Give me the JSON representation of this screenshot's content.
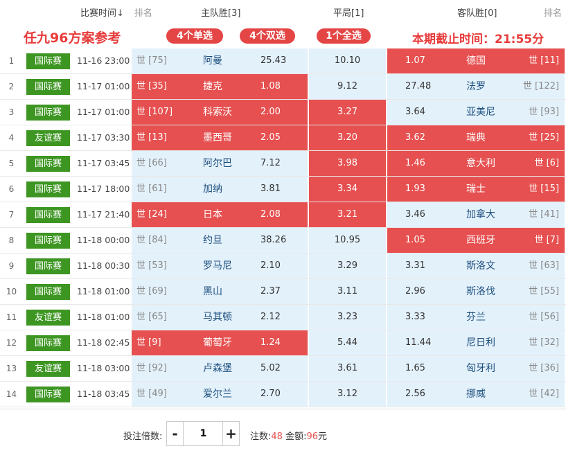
{
  "header": {
    "match_time": "比赛时间↓",
    "rank_left": "排名",
    "home_win": "主队胜[3]",
    "draw": "平局[1]",
    "away_win": "客队胜[0]",
    "rank_right": "排名"
  },
  "promo": {
    "title": "任九96方案参考",
    "single": "4个单选",
    "double": "4个双选",
    "full": "1个全选",
    "deadline": "本期截止时间：21:55分"
  },
  "matches": [
    {
      "no": "1",
      "league": "国际赛",
      "time": "11-16 23:00",
      "home_rank": "世 [75]",
      "home": "阿曼",
      "odds_home": "25.43",
      "odds_draw": "10.10",
      "odds_away": "1.07",
      "away": "德国",
      "away_rank": "世 [11]",
      "sel": [
        "away"
      ]
    },
    {
      "no": "2",
      "league": "国际赛",
      "time": "11-17 01:00",
      "home_rank": "世 [35]",
      "home": "捷克",
      "odds_home": "1.08",
      "odds_draw": "9.12",
      "odds_away": "27.48",
      "away": "法罗",
      "away_rank": "世 [122]",
      "sel": [
        "home"
      ]
    },
    {
      "no": "3",
      "league": "国际赛",
      "time": "11-17 01:00",
      "home_rank": "世 [107]",
      "home": "科索沃",
      "odds_home": "2.00",
      "odds_draw": "3.27",
      "odds_away": "3.64",
      "away": "亚美尼",
      "away_rank": "世 [93]",
      "sel": [
        "home",
        "draw"
      ]
    },
    {
      "no": "4",
      "league": "友谊赛",
      "time": "11-17 03:30",
      "home_rank": "世 [13]",
      "home": "墨西哥",
      "odds_home": "2.05",
      "odds_draw": "3.20",
      "odds_away": "3.62",
      "away": "瑞典",
      "away_rank": "世 [25]",
      "sel": [
        "home",
        "draw",
        "away"
      ]
    },
    {
      "no": "5",
      "league": "国际赛",
      "time": "11-17 03:45",
      "home_rank": "世 [66]",
      "home": "阿尔巴",
      "odds_home": "7.12",
      "odds_draw": "3.98",
      "odds_away": "1.46",
      "away": "意大利",
      "away_rank": "世 [6]",
      "sel": [
        "draw",
        "away"
      ]
    },
    {
      "no": "6",
      "league": "国际赛",
      "time": "11-17 18:00",
      "home_rank": "世 [61]",
      "home": "加纳",
      "odds_home": "3.81",
      "odds_draw": "3.34",
      "odds_away": "1.93",
      "away": "瑞士",
      "away_rank": "世 [15]",
      "sel": [
        "draw",
        "away"
      ]
    },
    {
      "no": "7",
      "league": "国际赛",
      "time": "11-17 21:40",
      "home_rank": "世 [24]",
      "home": "日本",
      "odds_home": "2.08",
      "odds_draw": "3.21",
      "odds_away": "3.46",
      "away": "加拿大",
      "away_rank": "世 [41]",
      "sel": [
        "home",
        "draw"
      ]
    },
    {
      "no": "8",
      "league": "国际赛",
      "time": "11-18 00:00",
      "home_rank": "世 [84]",
      "home": "约旦",
      "odds_home": "38.26",
      "odds_draw": "10.95",
      "odds_away": "1.05",
      "away": "西班牙",
      "away_rank": "世 [7]",
      "sel": [
        "away"
      ]
    },
    {
      "no": "9",
      "league": "国际赛",
      "time": "11-18 00:30",
      "home_rank": "世 [53]",
      "home": "罗马尼",
      "odds_home": "2.10",
      "odds_draw": "3.29",
      "odds_away": "3.31",
      "away": "斯洛文",
      "away_rank": "世 [63]",
      "sel": []
    },
    {
      "no": "10",
      "league": "国际赛",
      "time": "11-18 01:00",
      "home_rank": "世 [69]",
      "home": "黑山",
      "odds_home": "2.37",
      "odds_draw": "3.11",
      "odds_away": "2.96",
      "away": "斯洛伐",
      "away_rank": "世 [55]",
      "sel": []
    },
    {
      "no": "11",
      "league": "友谊赛",
      "time": "11-18 01:00",
      "home_rank": "世 [65]",
      "home": "马其顿",
      "odds_home": "2.12",
      "odds_draw": "3.23",
      "odds_away": "3.33",
      "away": "芬兰",
      "away_rank": "世 [56]",
      "sel": []
    },
    {
      "no": "12",
      "league": "国际赛",
      "time": "11-18 02:45",
      "home_rank": "世 [9]",
      "home": "葡萄牙",
      "odds_home": "1.24",
      "odds_draw": "5.44",
      "odds_away": "11.44",
      "away": "尼日利",
      "away_rank": "世 [32]",
      "sel": [
        "home"
      ]
    },
    {
      "no": "13",
      "league": "友谊赛",
      "time": "11-18 03:00",
      "home_rank": "世 [92]",
      "home": "卢森堡",
      "odds_home": "5.02",
      "odds_draw": "3.61",
      "odds_away": "1.65",
      "away": "匈牙利",
      "away_rank": "世 [36]",
      "sel": []
    },
    {
      "no": "14",
      "league": "国际赛",
      "time": "11-18 03:45",
      "home_rank": "世 [49]",
      "home": "爱尔兰",
      "odds_home": "2.70",
      "odds_draw": "3.12",
      "odds_away": "2.56",
      "away": "挪威",
      "away_rank": "世 [42]",
      "sel": []
    }
  ],
  "footer": {
    "multiplier_label": "投注倍数:",
    "minus": "-",
    "multiplier": "1",
    "plus": "+",
    "bets_label": "注数:",
    "bets": "48",
    "amount_label": "金额:",
    "amount": "96",
    "unit": "元"
  },
  "colors": {
    "badge": "#3d9622",
    "selected": "#e65050",
    "cell": "#e3f1fb",
    "accent": "#e83b3b"
  }
}
